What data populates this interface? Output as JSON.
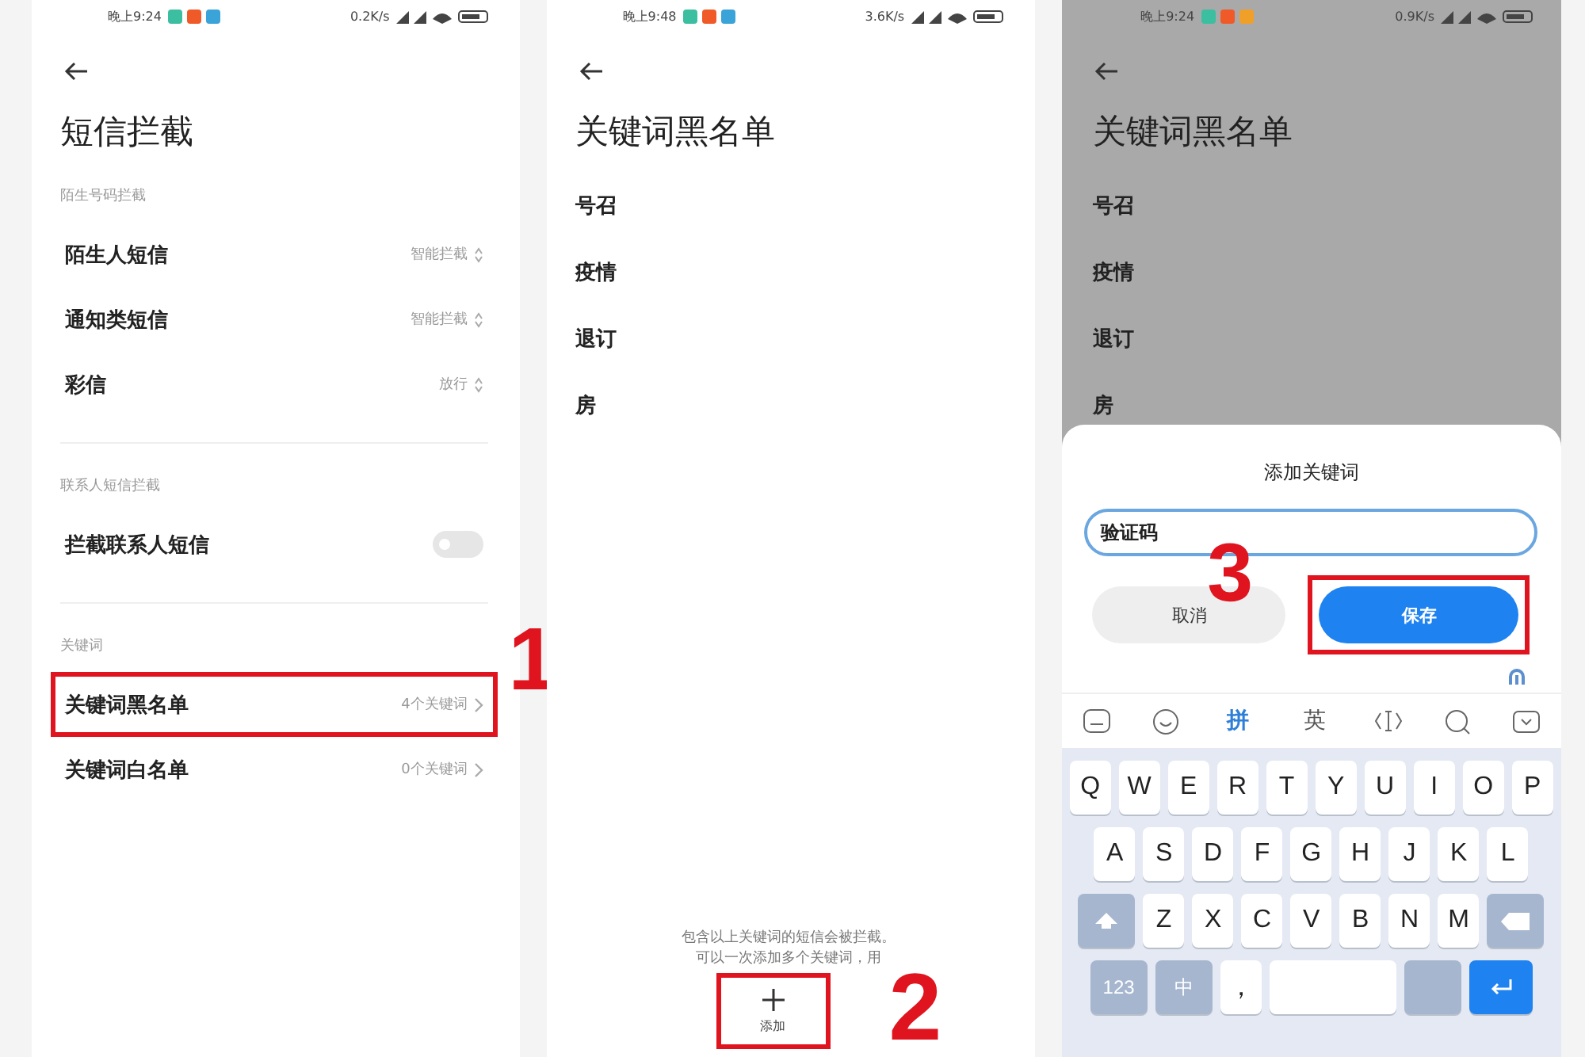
{
  "sms_filter_screen": {
    "status_bar": {
      "time": "晚上9:24",
      "speed": "0.2K/s"
    },
    "title": "短信拦截",
    "sections": [
      {
        "label": "陌生号码拦截",
        "items": [
          {
            "kind": "value",
            "label": "陌生人短信",
            "value": "智能拦截",
            "highlighted": false
          },
          {
            "kind": "value",
            "label": "通知类短信",
            "value": "智能拦截",
            "highlighted": false
          },
          {
            "kind": "value",
            "label": "彩信",
            "value": "放行",
            "highlighted": false
          }
        ]
      },
      {
        "label": "联系人短信拦截",
        "items": [
          {
            "kind": "toggle",
            "label": "拦截联系人短信",
            "on": false,
            "highlighted": false
          }
        ]
      },
      {
        "label": "关键词",
        "items": [
          {
            "kind": "link",
            "label": "关键词黑名单",
            "value": "4个关键词",
            "highlighted": true
          },
          {
            "kind": "link",
            "label": "关键词白名单",
            "value": "0个关键词",
            "highlighted": false
          }
        ]
      }
    ],
    "callout": "1"
  },
  "blacklist_screen": {
    "status_bar": {
      "time": "晚上9:48",
      "speed": "3.6K/s"
    },
    "title": "关键词黑名单",
    "keywords": [
      "号召",
      "疫情",
      "退订",
      "房"
    ],
    "footnote_lines": [
      "包含以上关键词的短信会被拦截。",
      "可以一次添加多个关键词，用"
    ],
    "add_button": {
      "label": "添加",
      "highlighted": true
    },
    "callout": "2"
  },
  "add_dialog_screen": {
    "status_bar": {
      "time": "晚上9:24",
      "speed": "0.9K/s"
    },
    "title": "关键词黑名单",
    "keywords": [
      "号召",
      "疫情",
      "退订",
      "房"
    ],
    "dialog": {
      "title": "添加关键词",
      "value": "验证码",
      "cancel": "取消",
      "save": {
        "label": "保存",
        "highlighted": true
      }
    },
    "keyboard": {
      "modes": [
        {
          "label": "拼",
          "selected": true
        },
        {
          "label": "英",
          "selected": false
        }
      ],
      "rows": [
        [
          "Q",
          "W",
          "E",
          "R",
          "T",
          "Y",
          "U",
          "I",
          "O",
          "P"
        ],
        [
          "A",
          "S",
          "D",
          "F",
          "G",
          "H",
          "J",
          "K",
          "L"
        ],
        [
          "Z",
          "X",
          "C",
          "V",
          "B",
          "N",
          "M"
        ]
      ],
      "bottom_keys": [
        "123",
        "中",
        "，"
      ]
    },
    "callout": "3"
  }
}
